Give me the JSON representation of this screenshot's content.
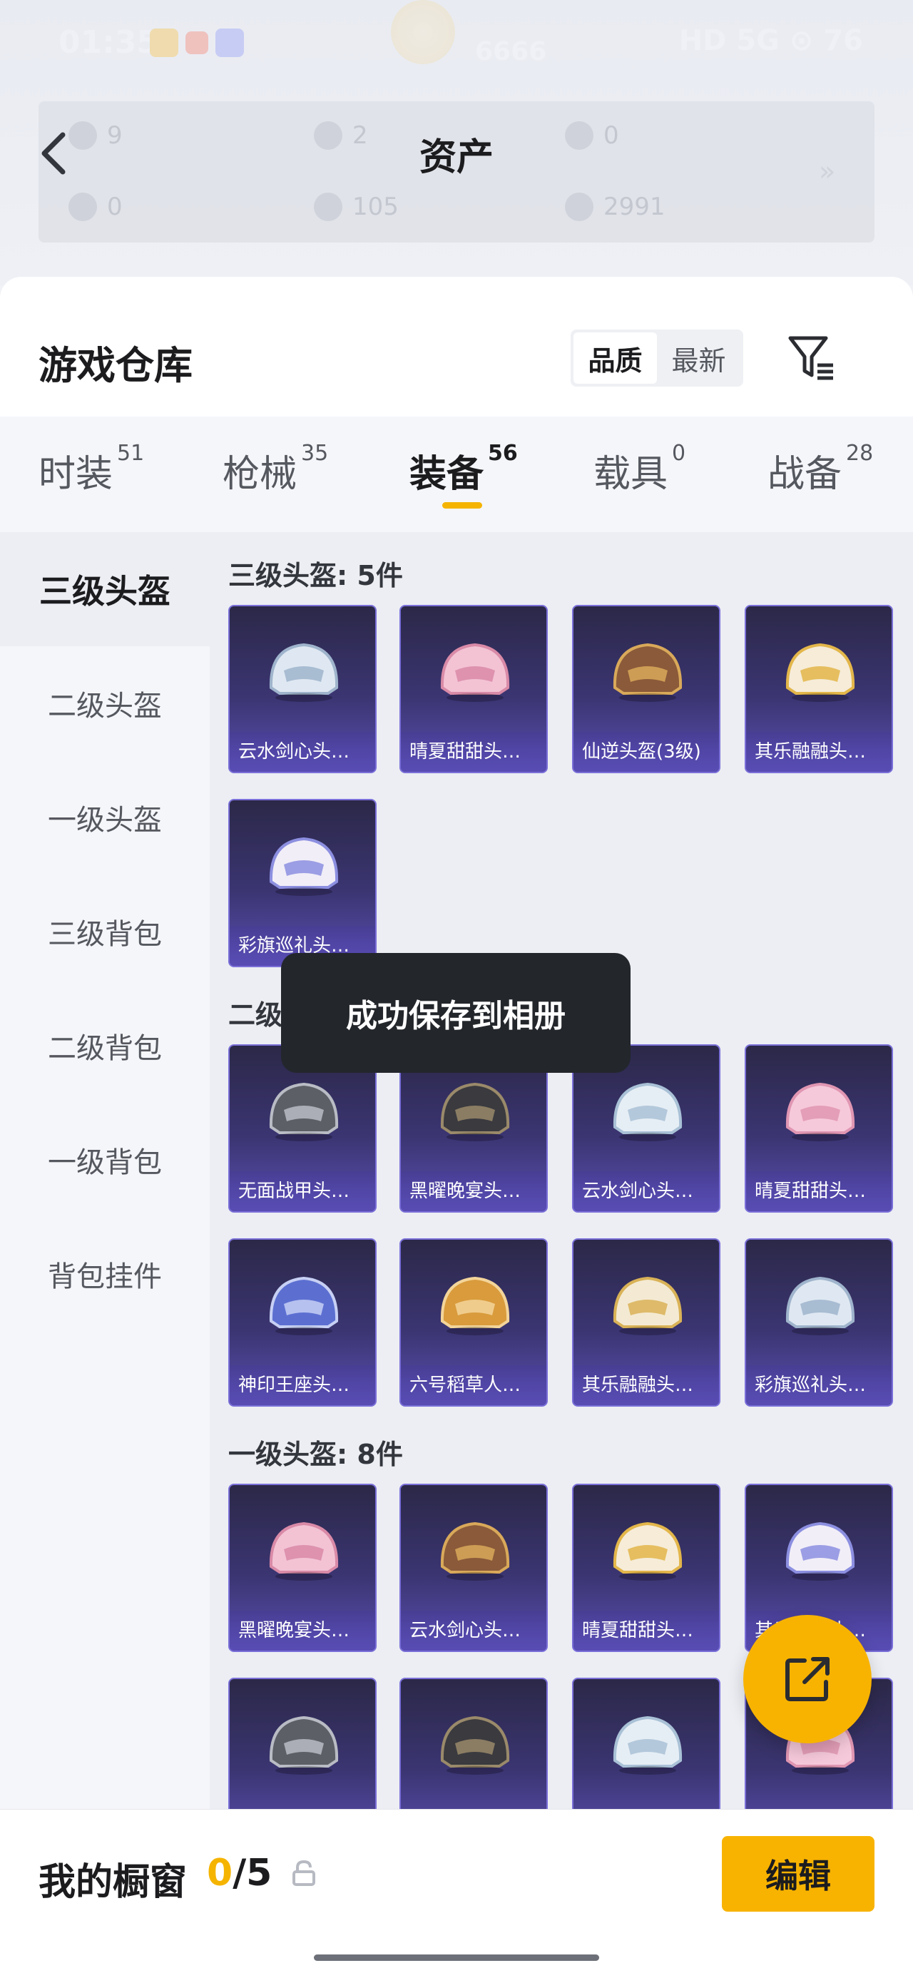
{
  "status_bar": {
    "time": "01:35",
    "center_label": "6666",
    "right": "HD 5G ⊙ 76"
  },
  "assets": {
    "title": "资产",
    "stats": [
      "9",
      "2",
      "0",
      "0",
      "105",
      "2991"
    ],
    "more": "»"
  },
  "warehouse": {
    "title": "游戏仓库",
    "sort_options": [
      "品质",
      "最新"
    ],
    "selected_sort": "品质"
  },
  "tabs": [
    {
      "label": "时装",
      "count": "51"
    },
    {
      "label": "枪械",
      "count": "35"
    },
    {
      "label": "装备",
      "count": "56"
    },
    {
      "label": "载具",
      "count": "0"
    },
    {
      "label": "战备",
      "count": "28"
    }
  ],
  "active_tab": "装备",
  "sidebar": {
    "items": [
      "三级头盔",
      "二级头盔",
      "一级头盔",
      "三级背包",
      "二级背包",
      "一级背包",
      "背包挂件"
    ],
    "active": "三级头盔"
  },
  "sections": [
    {
      "heading": "三级头盔: 5件",
      "items": [
        "云水剑心头盔...",
        "晴夏甜甜头盔...",
        "仙逆头盔(3级)",
        "其乐融融头盔...",
        "彩旗巡礼头盔..."
      ]
    },
    {
      "heading": "二级头盔: 8件",
      "items": [
        "无面战甲头盔...",
        "黑曜晚宴头盔...",
        "云水剑心头盔...",
        "晴夏甜甜头盔...",
        "神印王座头盔...",
        "六号稻草人头...",
        "其乐融融头盔...",
        "彩旗巡礼头盔..."
      ]
    },
    {
      "heading": "一级头盔: 8件",
      "items": [
        "黑曜晚宴头盔...",
        "云水剑心头盔...",
        "晴夏甜甜头盔...",
        "其乐融融头盔...",
        "",
        "",
        "",
        ""
      ]
    }
  ],
  "toast": "成功保存到相册",
  "showcase": {
    "label": "我的橱窗",
    "current": "0",
    "total": "/5",
    "edit_label": "编辑"
  },
  "colors": {
    "accent": "#F8B300",
    "card_purple": "#3B3572",
    "toast_bg": "#23262B"
  },
  "icons": [
    "back-arrow-icon",
    "filter-icon",
    "share-icon",
    "lock-icon",
    "helmet-icon"
  ]
}
